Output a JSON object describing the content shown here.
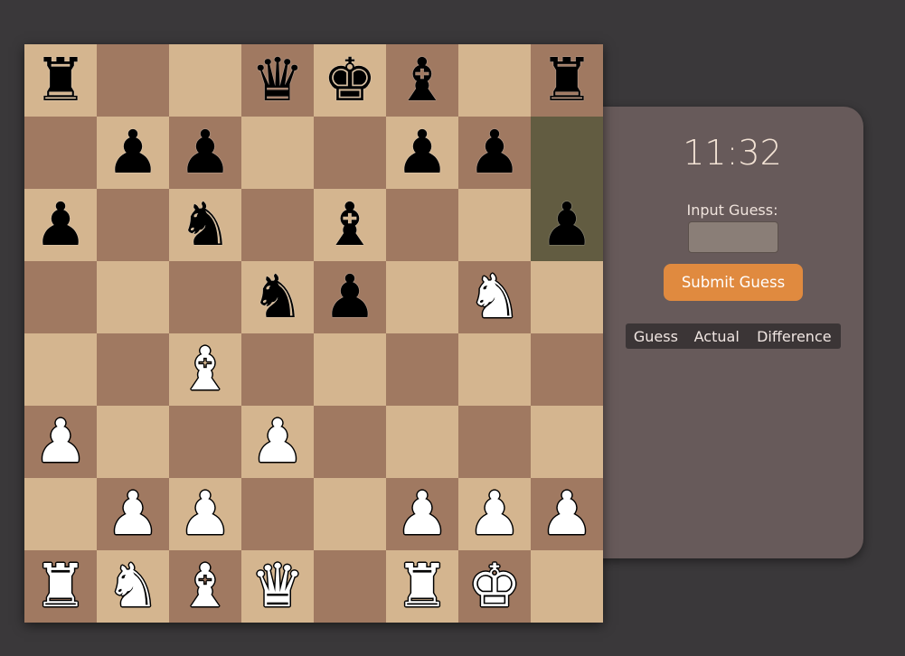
{
  "board": {
    "highlighted_squares": [
      "h7",
      "h6"
    ],
    "colors": {
      "light": "#d4b58f",
      "dark": "#a07961",
      "highlight": "#625c41"
    },
    "ranks": [
      [
        "r",
        "",
        "",
        "q",
        "k",
        "b",
        "",
        "r"
      ],
      [
        "",
        "p",
        "p",
        "",
        "",
        "p",
        "p",
        ""
      ],
      [
        "p",
        "",
        "n",
        "",
        "b",
        "",
        "",
        "p"
      ],
      [
        "",
        "",
        "",
        "n",
        "p",
        "",
        "N",
        ""
      ],
      [
        "",
        "",
        "B",
        "",
        "",
        "",
        "",
        ""
      ],
      [
        "P",
        "",
        "",
        "P",
        "",
        "",
        "",
        ""
      ],
      [
        "",
        "P",
        "P",
        "",
        "",
        "P",
        "P",
        "P"
      ],
      [
        "R",
        "N",
        "B",
        "Q",
        "",
        "R",
        "K",
        ""
      ]
    ]
  },
  "panel": {
    "timer": "11:32",
    "input_label": "Input Guess:",
    "input_value": "",
    "submit_label": "Submit Guess",
    "accent_color": "#e08a3f",
    "table_headers": [
      "Guess",
      "Actual",
      "Difference"
    ]
  }
}
